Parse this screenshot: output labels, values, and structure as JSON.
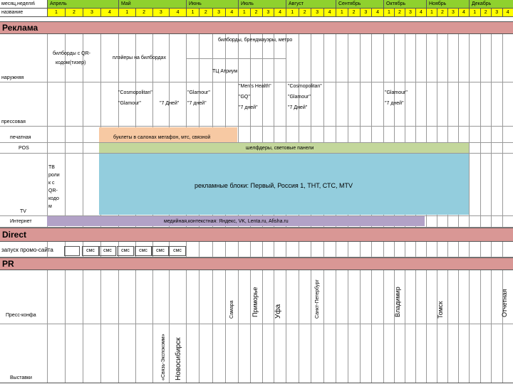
{
  "header": {
    "row1_label": "месяц,неделя\\",
    "row2_label": "название",
    "months": [
      "Апрель",
      "Май",
      "Июнь",
      "Июль",
      "Август",
      "Сентябрь",
      "Октябрь",
      "Ноябрь",
      "Декабрь"
    ],
    "weeks": [
      "1",
      "2",
      "3",
      "4"
    ]
  },
  "sections": {
    "reklama": "Реклама",
    "direct": "Direct",
    "pr": "PR"
  },
  "rows": {
    "naruzhnaya": "наружняя",
    "pressovaya": "прессовая",
    "pechatnaya": "печатная",
    "pos": "POS",
    "tv": "TV",
    "internet": "Интернет",
    "promo": "запуск промо-сайта",
    "press_konf": "Пресс-конфа",
    "vystavki": "Выставки"
  },
  "outdoor": {
    "billboards_qr": "билборды с QR-",
    "billboards_qr2": "кодом(тизер)",
    "playery": "плэйеры на билбордах",
    "billboards_brand": "билборды, брендмауэры, метро",
    "tc_atrium": "ТЦ Атриум"
  },
  "press": {
    "a1": "\"Cosmopolitan\"",
    "a2": "\"Glamour\"",
    "a3": "\"7 Дней\"",
    "b1": "\"Glamour\"",
    "b2": "\"7 дней\"",
    "c1": "\"Men's Health\"",
    "c2": "\"GQ\"",
    "c3": "\"7 дней\"",
    "d1": "\"Cosmopolitan\"",
    "d2": "\"Glamour\"",
    "d3": "\"7 Дней\"",
    "e1": "\"Glamour\"",
    "e2": "\"7 дней\""
  },
  "print_bar": "буклеты в салонах мегафон, мтс, связной",
  "pos_bar": "шелфдеры, световые панели",
  "tv_qr": [
    "ТВ",
    "роли",
    "к с",
    "QR-",
    "кодо",
    "м"
  ],
  "tv_bar": "рекламные блоки: Первый, Россия 1, ТНТ, СТС, MTV",
  "internet_bar": "медийная,контекстная: Яндекс, VK, Lenta.ru, Afisha.ru",
  "sms_label": "смс",
  "pr_cities": {
    "samara": "Самара",
    "primorye": "Приморье",
    "ufa": "Уфа",
    "spb": "Санкт-Петербург",
    "vladimir": "Владимир",
    "tomsk": "Томск",
    "otchetnaya": "Отчетная",
    "svyaz": "«Связь-Экспокомм»",
    "novosibirsk": "Новосибирск"
  },
  "colors": {
    "month_green": "#8fd12e",
    "week_yellow": "#ffff00",
    "section_pink": "#d99795",
    "print_orange": "#f7c9a3",
    "pos_green": "#c3d79b",
    "tv_blue": "#93cddd",
    "internet_purple": "#b2a2c7"
  }
}
